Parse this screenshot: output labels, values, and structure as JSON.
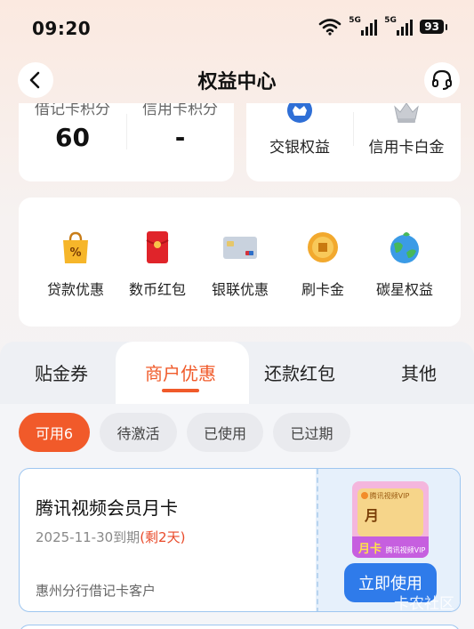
{
  "status_bar": {
    "time": "09:20",
    "network_1": "5G",
    "network_2": "5G",
    "battery": "93"
  },
  "header": {
    "title": "权益中心",
    "back_icon": "chevron-left-icon",
    "service_icon": "headset-icon"
  },
  "points": {
    "debit_label": "借记卡积分",
    "debit_value": "60",
    "credit_label": "信用卡积分",
    "credit_value": "-"
  },
  "rights": {
    "items": [
      {
        "label": "交银权益",
        "icon": "shield-crown-icon"
      },
      {
        "label": "信用卡白金",
        "icon": "silver-crown-icon"
      }
    ]
  },
  "services": {
    "items": [
      {
        "label": "贷款优惠",
        "icon": "shopping-bag-icon"
      },
      {
        "label": "数币红包",
        "icon": "red-envelope-icon"
      },
      {
        "label": "银联优惠",
        "icon": "bank-card-icon"
      },
      {
        "label": "刷卡金",
        "icon": "gold-coin-icon"
      },
      {
        "label": "碳星权益",
        "icon": "earth-icon"
      }
    ]
  },
  "tabs": [
    {
      "label": "贴金券"
    },
    {
      "label": "商户优惠"
    },
    {
      "label": "还款红包"
    },
    {
      "label": "其他"
    }
  ],
  "filters": [
    {
      "label": "可用6"
    },
    {
      "label": "待激活"
    },
    {
      "label": "已使用"
    },
    {
      "label": "已过期"
    }
  ],
  "coupon": {
    "title": "腾讯视频会员月卡",
    "expiry": "2025-11-30到期",
    "remaining": "(剩2天)",
    "owner": "惠州分行借记卡客户",
    "button": "立即使用",
    "thumb_brand": "腾讯视频VIP",
    "thumb_big": "月卡",
    "thumb_small": "月",
    "thumb_tag": "月卡"
  },
  "watermark": "卡农社区",
  "colors": {
    "accent": "#f05a2a",
    "primary_button": "#2f7bea",
    "coupon_border": "#9ec6f0"
  }
}
